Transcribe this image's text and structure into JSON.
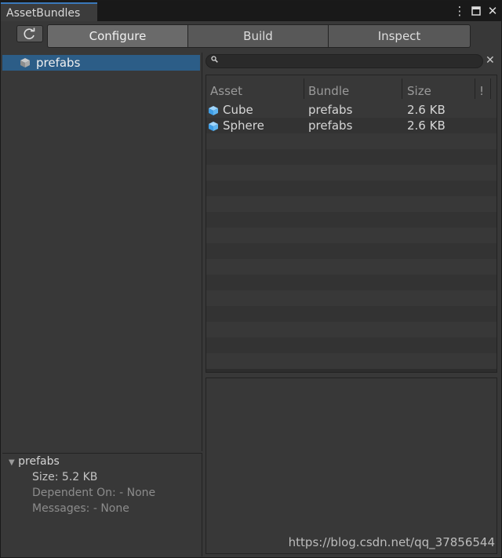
{
  "window": {
    "title": "AssetBundles",
    "controls": {
      "menu": "⋮",
      "maximize": "□",
      "close": "✕"
    }
  },
  "toolbar": {
    "refresh_icon": "↻",
    "tabs": [
      "Configure",
      "Build",
      "Inspect"
    ],
    "active_tab": "Configure"
  },
  "bundle_list": {
    "items": [
      {
        "name": "prefabs",
        "icon": "cube-icon"
      }
    ]
  },
  "details": {
    "title": "prefabs",
    "size": "Size: 5.2 KB",
    "dependent_on": "Dependent On: - None",
    "messages": "Messages: - None"
  },
  "search": {
    "placeholder": "",
    "clear_icon": "✕"
  },
  "table": {
    "columns": [
      "Asset",
      "Bundle",
      "Size",
      "!"
    ],
    "rows": [
      {
        "asset": "Cube",
        "bundle": "prefabs",
        "size": "2.6 KB"
      },
      {
        "asset": "Sphere",
        "bundle": "prefabs",
        "size": "2.6 KB"
      }
    ]
  },
  "watermark": "https://blog.csdn.net/qq_37856544",
  "colors": {
    "selection": "#2c5d87",
    "tab_accent": "#3a79bb",
    "cube_icon": "#5fb4f0"
  }
}
